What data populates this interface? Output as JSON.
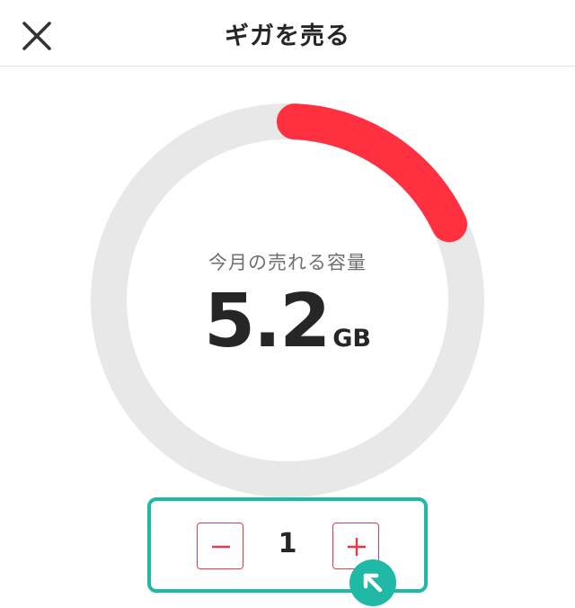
{
  "header": {
    "title": "ギガを売る",
    "close_icon": "close-icon"
  },
  "gauge": {
    "label": "今月の売れる容量",
    "value": "5.2",
    "unit": "GB",
    "fill_fraction": 0.18,
    "track_color": "#e8e8e8",
    "fill_color": "#ff3040"
  },
  "stepper": {
    "value": "1",
    "minus_icon": "minus-icon",
    "plus_icon": "plus-icon",
    "button_color": "#e83a46"
  },
  "highlight": {
    "color": "#1fb9a6",
    "cursor_icon": "arrow-up-left-icon"
  }
}
